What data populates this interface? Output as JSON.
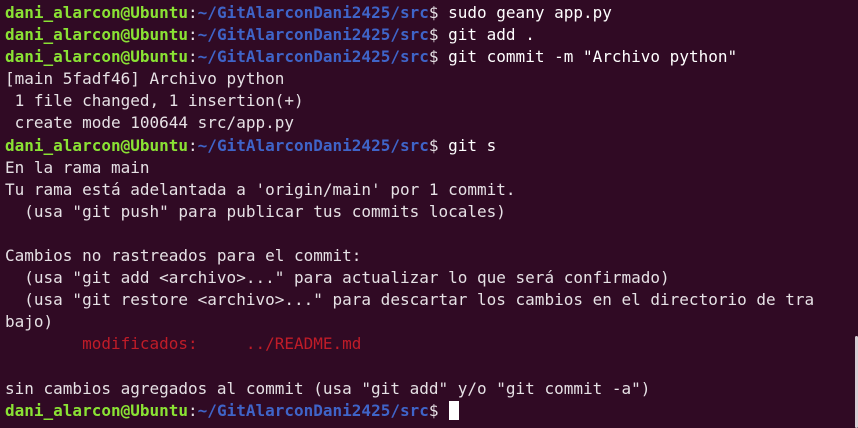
{
  "prompt": {
    "user": "dani_alarcon@Ubuntu",
    "colon": ":",
    "path": "~/GitAlarconDani2425/src",
    "symbol": "$ "
  },
  "lines": [
    {
      "kind": "prompt",
      "command": "sudo geany app.py"
    },
    {
      "kind": "prompt",
      "command": "git add ."
    },
    {
      "kind": "prompt",
      "command": "git commit -m \"Archivo python\""
    },
    {
      "kind": "out",
      "text": "[main 5fadf46] Archivo python"
    },
    {
      "kind": "out",
      "text": " 1 file changed, 1 insertion(+)"
    },
    {
      "kind": "out",
      "text": " create mode 100644 src/app.py"
    },
    {
      "kind": "prompt",
      "command": "git s"
    },
    {
      "kind": "out",
      "text": "En la rama main"
    },
    {
      "kind": "out",
      "text": "Tu rama está adelantada a 'origin/main' por 1 commit."
    },
    {
      "kind": "out",
      "text": "  (usa \"git push\" para publicar tus commits locales)"
    },
    {
      "kind": "out",
      "text": ""
    },
    {
      "kind": "out",
      "text": "Cambios no rastreados para el commit:"
    },
    {
      "kind": "out",
      "text": "  (usa \"git add <archivo>...\" para actualizar lo que será confirmado)"
    },
    {
      "kind": "out",
      "text": "  (usa \"git restore <archivo>...\" para descartar los cambios en el directorio de tra"
    },
    {
      "kind": "out",
      "text": "bajo)"
    },
    {
      "kind": "mod",
      "text": "\tmodificados:     ../README.md"
    },
    {
      "kind": "out",
      "text": ""
    },
    {
      "kind": "out",
      "text": "sin cambios agregados al commit (usa \"git add\" y/o \"git commit -a\")"
    },
    {
      "kind": "prompt",
      "command": "",
      "cursor": true
    }
  ],
  "colors": {
    "background": "#300a24",
    "user": "#8ae234",
    "path": "#3f64c8",
    "text": "#e6e1e5",
    "modified": "#c01c28"
  }
}
